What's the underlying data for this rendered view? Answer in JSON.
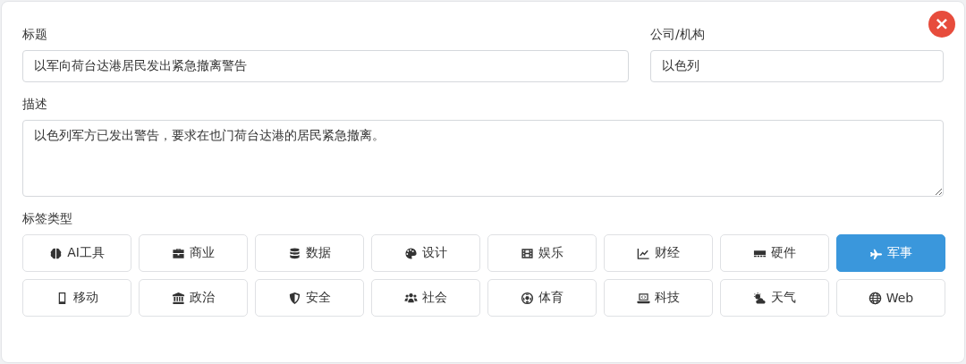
{
  "close_button": {
    "label": "×"
  },
  "title_field": {
    "label": "标题",
    "value": "以军向荷台达港居民发出紧急撤离警告"
  },
  "company_field": {
    "label": "公司/机构",
    "value": "以色列"
  },
  "description_field": {
    "label": "描述",
    "value": "以色列军方已发出警告，要求在也门荷台达港的居民紧急撤离。"
  },
  "tag_types": {
    "label": "标签类型",
    "items": [
      {
        "label": "AI工具",
        "kind": "brain",
        "selected": false
      },
      {
        "label": "商业",
        "kind": "briefcase",
        "selected": false
      },
      {
        "label": "数据",
        "kind": "database",
        "selected": false
      },
      {
        "label": "设计",
        "kind": "palette",
        "selected": false
      },
      {
        "label": "娱乐",
        "kind": "film",
        "selected": false
      },
      {
        "label": "财经",
        "kind": "chart",
        "selected": false
      },
      {
        "label": "硬件",
        "kind": "memory",
        "selected": false
      },
      {
        "label": "军事",
        "kind": "plane",
        "selected": true
      },
      {
        "label": "移动",
        "kind": "phone",
        "selected": false
      },
      {
        "label": "政治",
        "kind": "bank",
        "selected": false
      },
      {
        "label": "安全",
        "kind": "shield",
        "selected": false
      },
      {
        "label": "社会",
        "kind": "users",
        "selected": false
      },
      {
        "label": "体育",
        "kind": "ball",
        "selected": false
      },
      {
        "label": "科技",
        "kind": "laptop",
        "selected": false
      },
      {
        "label": "天气",
        "kind": "weather",
        "selected": false
      },
      {
        "label": "Web",
        "kind": "globe",
        "selected": false
      }
    ]
  }
}
